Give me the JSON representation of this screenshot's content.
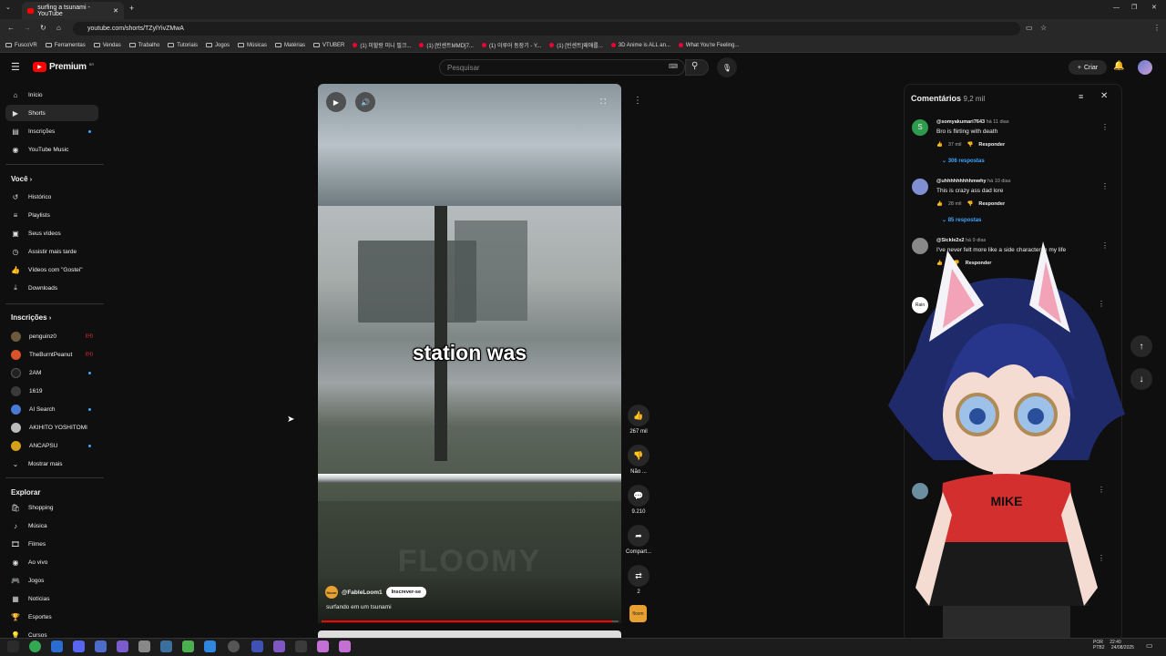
{
  "browser": {
    "tab_title": "surfing a tsunami - YouTube",
    "url": "youtube.com/shorts/TZylYivZMwA",
    "bookmarks": [
      "FuscoVR",
      "Ferramentas",
      "Vendas",
      "Trabalho",
      "Tutoriais",
      "Jogos",
      "Músicas",
      "Matérias",
      "VTUBER",
      "(1) 미할랑 미니 필크...",
      "(1) [빈센트MMD]7...",
      "(1) 이루어 동장기 - Y...",
      "(1) [빈센트]왜애를...",
      "3D Anime is ALL an...",
      "What You're Feeling..."
    ]
  },
  "header": {
    "logo": "Premium",
    "logo_region": "BR",
    "search_placeholder": "Pesquisar",
    "create_label": "Criar"
  },
  "sidebar": {
    "main": [
      {
        "label": "Início",
        "icon": "home-icon"
      },
      {
        "label": "Shorts",
        "icon": "shorts-icon",
        "active": true
      },
      {
        "label": "Inscrições",
        "icon": "subscriptions-icon"
      },
      {
        "label": "YouTube Music",
        "icon": "music-icon"
      }
    ],
    "you_title": "Você",
    "you": [
      {
        "label": "Histórico",
        "icon": "history-icon"
      },
      {
        "label": "Playlists",
        "icon": "playlists-icon"
      },
      {
        "label": "Seus vídeos",
        "icon": "your-videos-icon"
      },
      {
        "label": "Assistir mais tarde",
        "icon": "watch-later-icon"
      },
      {
        "label": "Vídeos com \"Gostei\"",
        "icon": "like-icon"
      },
      {
        "label": "Downloads",
        "icon": "download-icon"
      }
    ],
    "subs_title": "Inscrições",
    "subs": [
      {
        "label": "penguinz0",
        "color": "#6b5a3e",
        "badge": "live"
      },
      {
        "label": "TheBurntPeanut",
        "color": "#d9532b",
        "badge": "live"
      },
      {
        "label": "2AM",
        "color": "#222222",
        "badge": "dot"
      },
      {
        "label": "1619",
        "color": "#3a3a3a",
        "badge": ""
      },
      {
        "label": "AI Search",
        "color": "#4a7bd4",
        "badge": "dot"
      },
      {
        "label": "AKIHITO YOSHITOMI",
        "color": "#bbbbbb",
        "badge": ""
      },
      {
        "label": "ANCAPSU",
        "color": "#d4a017",
        "badge": "dot"
      }
    ],
    "show_more": "Mostrar mais",
    "explore_title": "Explorar",
    "explore": [
      {
        "label": "Shopping",
        "icon": "shopping-icon"
      },
      {
        "label": "Música",
        "icon": "music-note-icon"
      },
      {
        "label": "Filmes",
        "icon": "film-icon"
      },
      {
        "label": "Ao vivo",
        "icon": "live-icon"
      },
      {
        "label": "Jogos",
        "icon": "gaming-icon"
      },
      {
        "label": "Notícias",
        "icon": "news-icon"
      },
      {
        "label": "Esportes",
        "icon": "sports-icon"
      },
      {
        "label": "Cursos",
        "icon": "courses-icon"
      }
    ]
  },
  "short": {
    "caption": "station was",
    "channel": "@FableLoom1",
    "channel_badge": "floom",
    "subscribe": "Inscrever-se",
    "description": "surfando em um tsunami",
    "watermark": "FLOOMY",
    "progress": 0.98
  },
  "actions": {
    "likes": "267 mil",
    "dislike": "Não ...",
    "comments": "9.210",
    "share": "Compart...",
    "remix": "2",
    "channel_badge": "floom"
  },
  "comments": {
    "title": "Comentários",
    "count": "9,2 mil",
    "items": [
      {
        "author": "@somyakumari7643",
        "time": "há 11 dias",
        "text": "Bro is flirting with death",
        "likes": "37 mil",
        "reply": "Responder",
        "replies": "306 respostas",
        "avatar_color": "#2e9a4e",
        "avatar_letter": "S"
      },
      {
        "author": "@uhhhhhhhhhmwhy",
        "time": "há 10 dias",
        "text": "This is crazy ass dad lore",
        "likes": "28 mil",
        "reply": "Responder",
        "replies": "85 respostas",
        "avatar_color": "#7f8fd1",
        "avatar_letter": ""
      },
      {
        "author": "@Sickle2x2",
        "time": "há 9 dias",
        "text": "I've never felt more like a side character in my life",
        "likes": "",
        "reply": "Responder",
        "replies": "",
        "avatar_color": "#888888",
        "avatar_letter": ""
      }
    ]
  },
  "taskbar": {
    "lang": "POR",
    "layout": "PTB2",
    "time": "22:40",
    "date": "24/08/2025"
  }
}
